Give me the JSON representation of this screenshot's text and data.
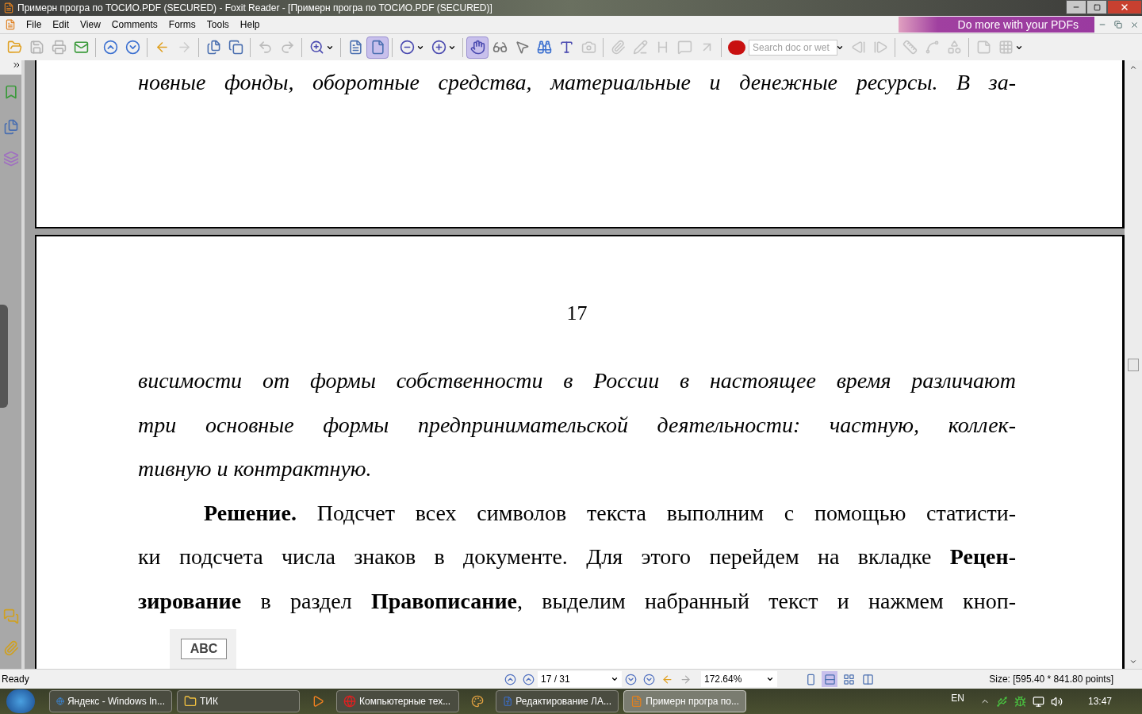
{
  "window": {
    "title": "Примерн програ по ТОСИО.PDF (SECURED) - Foxit Reader - [Примерн програ по ТОСИО.PDF (SECURED)]"
  },
  "menu": [
    "File",
    "Edit",
    "View",
    "Comments",
    "Forms",
    "Tools",
    "Help"
  ],
  "ad_banner": "Do more with your PDFs",
  "toolbar": [
    {
      "kind": "open",
      "selected": false,
      "disabled": false
    },
    {
      "kind": "save",
      "selected": false,
      "disabled": true
    },
    {
      "kind": "print",
      "selected": false,
      "disabled": true
    },
    {
      "kind": "email",
      "selected": false,
      "disabled": false
    },
    {
      "kind": "separator"
    },
    {
      "kind": "prev-page",
      "selected": false,
      "disabled": false
    },
    {
      "kind": "next-page",
      "selected": false,
      "disabled": false
    },
    {
      "kind": "separator"
    },
    {
      "kind": "back",
      "selected": false,
      "disabled": false
    },
    {
      "kind": "forward",
      "selected": false,
      "disabled": true
    },
    {
      "kind": "separator"
    },
    {
      "kind": "extract",
      "selected": false,
      "disabled": false
    },
    {
      "kind": "insert",
      "selected": false,
      "disabled": false
    },
    {
      "kind": "separator"
    },
    {
      "kind": "undo",
      "selected": false,
      "disabled": true
    },
    {
      "kind": "redo",
      "selected": false,
      "disabled": true
    },
    {
      "kind": "separator"
    },
    {
      "kind": "zoom",
      "selected": false,
      "disabled": false
    },
    {
      "kind": "dropdown"
    },
    {
      "kind": "separator"
    },
    {
      "kind": "fit-page",
      "selected": false,
      "disabled": false
    },
    {
      "kind": "fit-width",
      "selected": true,
      "disabled": false
    },
    {
      "kind": "separator"
    },
    {
      "kind": "zoom-out",
      "selected": false,
      "disabled": false
    },
    {
      "kind": "dropdown"
    },
    {
      "kind": "zoom-in",
      "selected": false,
      "disabled": false
    },
    {
      "kind": "dropdown"
    },
    {
      "kind": "separator"
    },
    {
      "kind": "hand",
      "selected": true,
      "disabled": false
    },
    {
      "kind": "select",
      "selected": false,
      "disabled": false
    },
    {
      "kind": "cursor",
      "selected": false,
      "disabled": false
    },
    {
      "kind": "find",
      "selected": false,
      "disabled": false
    },
    {
      "kind": "text-select",
      "selected": false,
      "disabled": false
    },
    {
      "kind": "snapshot",
      "selected": false,
      "disabled": true
    },
    {
      "kind": "separator"
    },
    {
      "kind": "attach",
      "selected": false,
      "disabled": true
    },
    {
      "kind": "pencil",
      "selected": false,
      "disabled": true
    },
    {
      "kind": "textbox",
      "selected": false,
      "disabled": true
    },
    {
      "kind": "note",
      "selected": false,
      "disabled": true
    },
    {
      "kind": "arrow",
      "selected": false,
      "disabled": true
    },
    {
      "kind": "separator"
    },
    {
      "kind": "ask"
    },
    {
      "kind": "search",
      "placeholder": "Search doc or wet"
    },
    {
      "kind": "dropdown"
    },
    {
      "kind": "prev-result",
      "selected": false,
      "disabled": true
    },
    {
      "kind": "next-result",
      "selected": false,
      "disabled": true
    },
    {
      "kind": "separator"
    },
    {
      "kind": "distance",
      "selected": false,
      "disabled": true
    },
    {
      "kind": "perimeter",
      "selected": false,
      "disabled": true
    },
    {
      "kind": "area",
      "selected": false,
      "disabled": true
    },
    {
      "kind": "separator"
    },
    {
      "kind": "page",
      "selected": false,
      "disabled": true
    },
    {
      "kind": "pattern",
      "selected": false,
      "disabled": true
    },
    {
      "kind": "dropdown"
    }
  ],
  "page_1": {
    "lines": [
      "новные фонды, оборотные средства, материальные и денежные ресурсы. В за-"
    ]
  },
  "page_2": {
    "page_number": "17",
    "lines": [
      {
        "text": "висимости от формы собственности в России в настоящее время различают",
        "italic": true,
        "indent": false,
        "last": false
      },
      {
        "text": "три основные формы предпринимательской деятельности: частную, коллек-",
        "italic": true,
        "indent": false,
        "last": false
      },
      {
        "text": "тивную и контрактную.",
        "italic": true,
        "indent": false,
        "last": true
      },
      {
        "text": "**Решение.** Подсчет всех символов текста выполним с помощью статисти-",
        "italic": false,
        "indent": true,
        "last": false
      },
      {
        "text": "ки подсчета числа знаков в документе. Для этого перейдем на вкладке **Рецен-**",
        "italic": false,
        "indent": false,
        "last": false
      },
      {
        "text": "**зирование** в раздел **Правописание**, выделим набранный текст и нажмем кноп-",
        "italic": false,
        "indent": false,
        "last": false
      }
    ],
    "spelling_button_label": "ABC"
  },
  "status_bar": {
    "text": "Ready",
    "page": "17 / 31",
    "zoom": "172.64%",
    "size": "Size: [595.40 * 841.80 points]",
    "view_modes": [
      {
        "kind": "single",
        "selected": false
      },
      {
        "kind": "continuous",
        "selected": true
      },
      {
        "kind": "facing",
        "selected": false
      },
      {
        "kind": "continuous-facing",
        "selected": false
      }
    ]
  },
  "taskbar": {
    "items": [
      {
        "kind": "browser",
        "label": "Яндекс - Windows In...",
        "selected": false
      },
      {
        "kind": "folder",
        "label": "ТИК",
        "selected": false
      },
      {
        "kind": "player",
        "selected": false
      },
      {
        "kind": "opera",
        "label": "Компьютерные тех...",
        "selected": false
      },
      {
        "kind": "paint",
        "selected": false
      },
      {
        "kind": "word",
        "label": "Редактирование ЛА...",
        "selected": false
      },
      {
        "kind": "reader",
        "label": "Примерн програ по...",
        "selected": true
      }
    ],
    "language": "EN",
    "clock": "13:47"
  }
}
